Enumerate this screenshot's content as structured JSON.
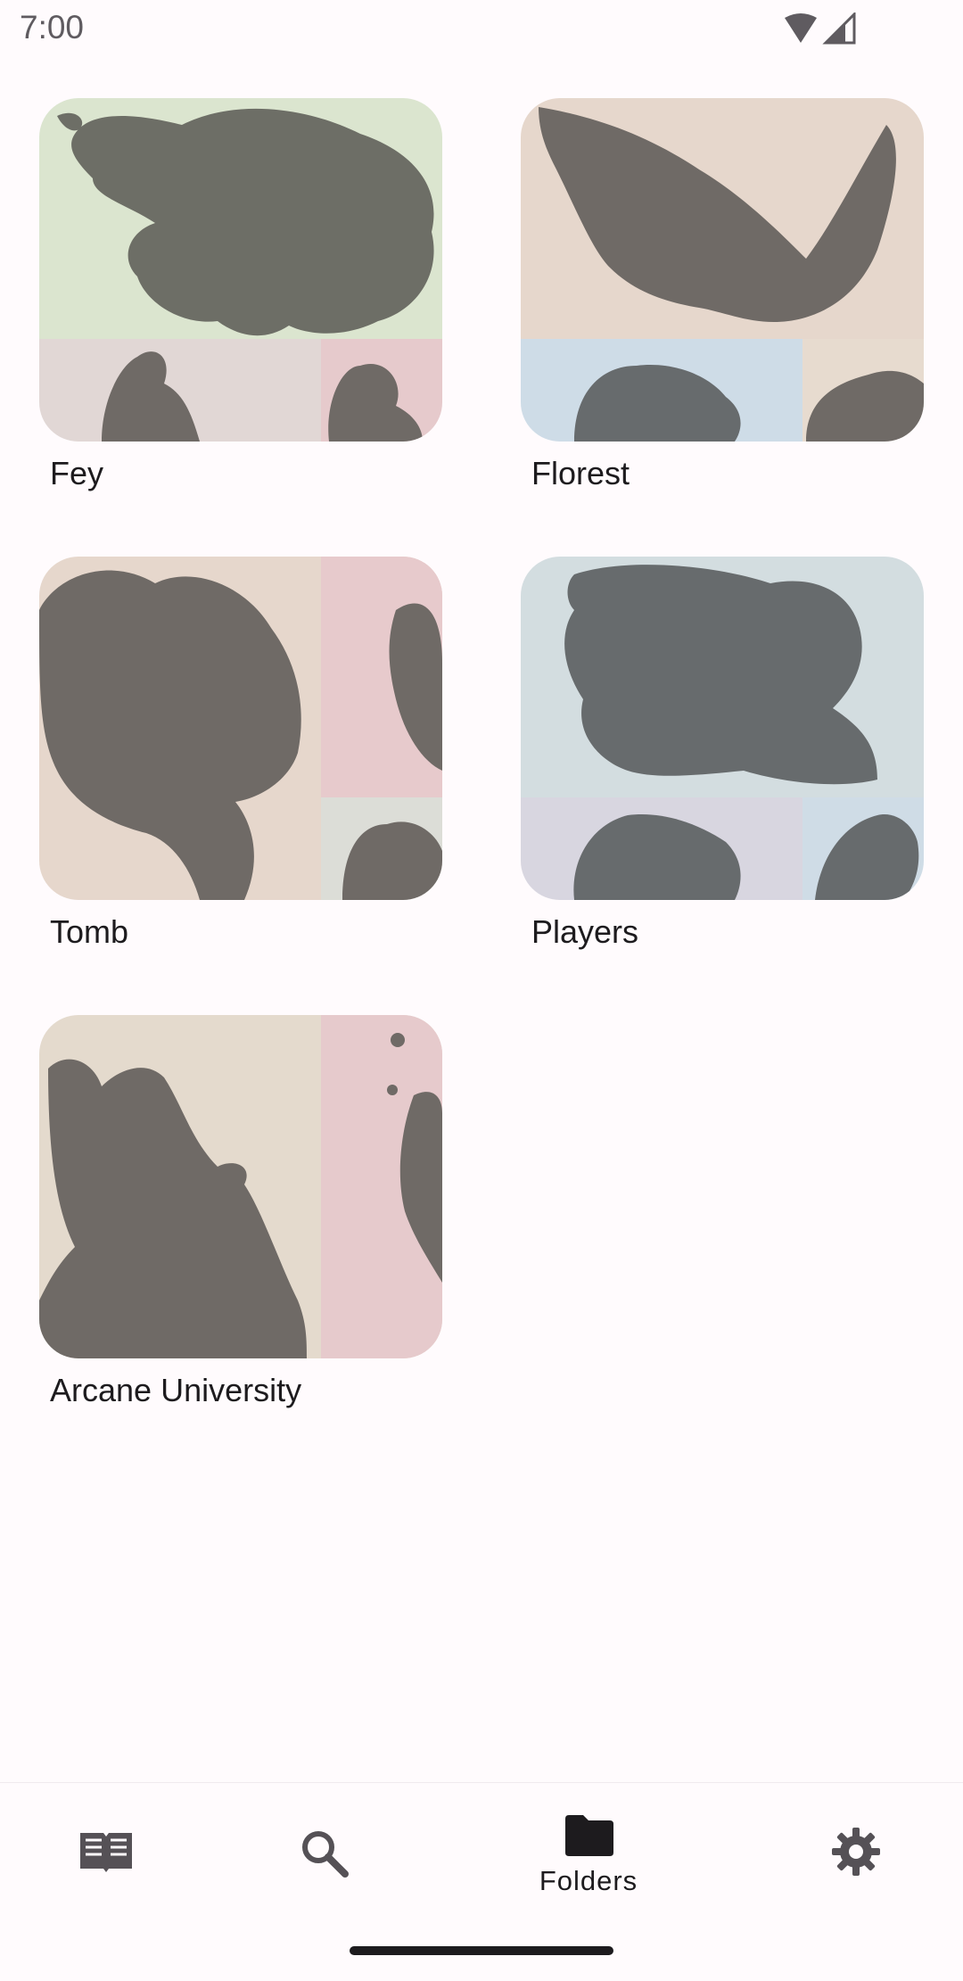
{
  "status_bar": {
    "time": "7:00",
    "icons": [
      "wifi-icon",
      "cellular-signal-icon"
    ]
  },
  "folders": [
    {
      "name": "Fey",
      "tile_colors": {
        "main": "#dbe5cf",
        "bottom_left": "#e1d7d5",
        "bottom_right": "#e6cacc",
        "silhouette": "#6d6e66"
      }
    },
    {
      "name": "Florest",
      "tile_colors": {
        "main": "#e6d7cc",
        "bottom_left": "#cedce7",
        "bottom_right": "#e7dbcf",
        "silhouette": "#6f6a66"
      }
    },
    {
      "name": "Tomb",
      "tile_colors": {
        "main": "#e6d7cc",
        "top_right": "#e7cacc",
        "bottom_right": "#dcddd7",
        "silhouette": "#6f6a66"
      }
    },
    {
      "name": "Players",
      "tile_colors": {
        "main": "#d3dde0",
        "bottom_left": "#d8d6e0",
        "bottom_right": "#cfdce6",
        "silhouette": "#676b6d"
      }
    },
    {
      "name": "Arcane University",
      "tile_colors": {
        "main": "#e4dacd",
        "right": "#e6cacc",
        "silhouette": "#6f6a66"
      }
    }
  ],
  "bottom_nav": {
    "items": [
      {
        "icon": "book-icon",
        "label": ""
      },
      {
        "icon": "search-icon",
        "label": ""
      },
      {
        "icon": "folder-icon",
        "label": "Folders",
        "selected": true
      },
      {
        "icon": "gear-icon",
        "label": ""
      }
    ]
  }
}
